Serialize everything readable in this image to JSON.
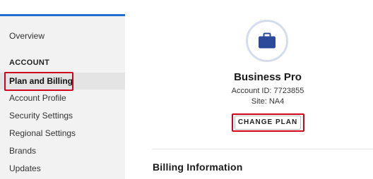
{
  "sidebar": {
    "items": [
      {
        "label": "Overview"
      },
      {
        "label": "Plan and Billing"
      },
      {
        "label": "Account Profile"
      },
      {
        "label": "Security Settings"
      },
      {
        "label": "Regional Settings"
      },
      {
        "label": "Brands"
      },
      {
        "label": "Updates"
      }
    ],
    "section_label": "ACCOUNT"
  },
  "account": {
    "plan_name": "Business Pro",
    "account_id": "Account ID: 7723855",
    "site": "Site: NA4",
    "icon": "briefcase-icon"
  },
  "actions": {
    "change_plan_label": "CHANGE PLAN"
  },
  "billing": {
    "title": "Billing Information"
  },
  "colors": {
    "accent_blue": "#1f6fd1",
    "icon_navy": "#2c4a9a",
    "highlight_red": "#d0021b",
    "sidebar_bg": "#f2f2f2"
  }
}
